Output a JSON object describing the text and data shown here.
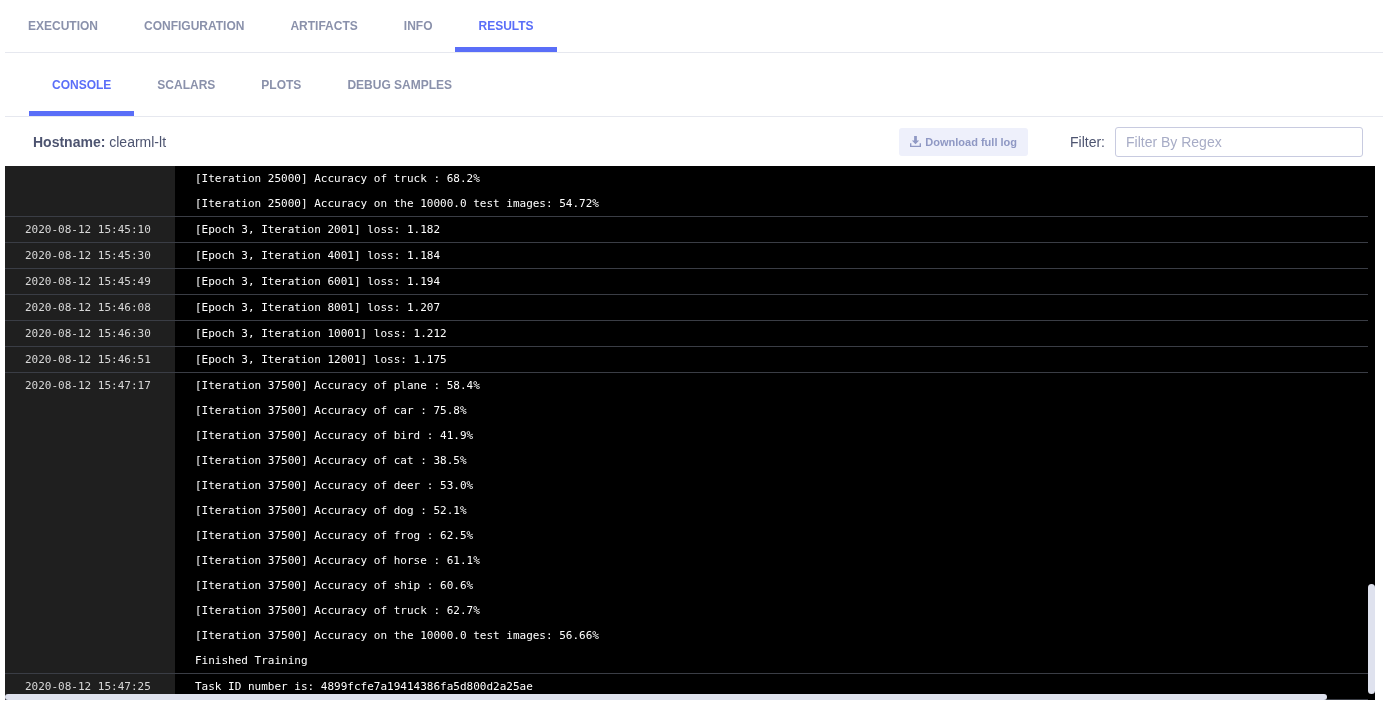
{
  "tabs": [
    {
      "label": "EXECUTION",
      "selected": false
    },
    {
      "label": "CONFIGURATION",
      "selected": false
    },
    {
      "label": "ARTIFACTS",
      "selected": false
    },
    {
      "label": "INFO",
      "selected": false
    },
    {
      "label": "RESULTS",
      "selected": true
    }
  ],
  "subtabs": [
    {
      "label": "CONSOLE",
      "selected": true
    },
    {
      "label": "SCALARS",
      "selected": false
    },
    {
      "label": "PLOTS",
      "selected": false
    },
    {
      "label": "DEBUG SAMPLES",
      "selected": false
    }
  ],
  "toolbar": {
    "hostname_label": "Hostname:",
    "hostname": "clearml-lt",
    "download_button": "Download full log",
    "filter_label": "Filter:",
    "filter_placeholder": "Filter By Regex"
  },
  "log": [
    {
      "lines": [
        "[Iteration 25000] Accuracy of truck : 68.2%",
        "[Iteration 25000] Accuracy on the 10000.0 test images: 54.72%"
      ]
    },
    {
      "timestamp": "2020-08-12 15:45:10",
      "lines": [
        "[Epoch 3, Iteration 2001] loss: 1.182"
      ]
    },
    {
      "timestamp": "2020-08-12 15:45:30",
      "lines": [
        "[Epoch 3, Iteration 4001] loss: 1.184"
      ]
    },
    {
      "timestamp": "2020-08-12 15:45:49",
      "lines": [
        "[Epoch 3, Iteration 6001] loss: 1.194"
      ]
    },
    {
      "timestamp": "2020-08-12 15:46:08",
      "lines": [
        "[Epoch 3, Iteration 8001] loss: 1.207"
      ]
    },
    {
      "timestamp": "2020-08-12 15:46:30",
      "lines": [
        "[Epoch 3, Iteration 10001] loss: 1.212"
      ]
    },
    {
      "timestamp": "2020-08-12 15:46:51",
      "lines": [
        "[Epoch 3, Iteration 12001] loss: 1.175"
      ]
    },
    {
      "timestamp": "2020-08-12 15:47:17",
      "lines": [
        "[Iteration 37500] Accuracy of plane : 58.4%",
        "[Iteration 37500] Accuracy of car : 75.8%",
        "[Iteration 37500] Accuracy of bird : 41.9%",
        "[Iteration 37500] Accuracy of cat : 38.5%",
        "[Iteration 37500] Accuracy of deer : 53.0%",
        "[Iteration 37500] Accuracy of dog : 52.1%",
        "[Iteration 37500] Accuracy of frog : 62.5%",
        "[Iteration 37500] Accuracy of horse : 61.1%",
        "[Iteration 37500] Accuracy of ship : 60.6%",
        "[Iteration 37500] Accuracy of truck : 62.7%",
        "[Iteration 37500] Accuracy on the 10000.0 test images: 56.66%",
        "Finished Training"
      ]
    },
    {
      "timestamp": "2020-08-12 15:47:25",
      "lines": [
        "Task ID number is: 4899fcfe7a19414386fa5d800d2a25ae"
      ]
    }
  ]
}
